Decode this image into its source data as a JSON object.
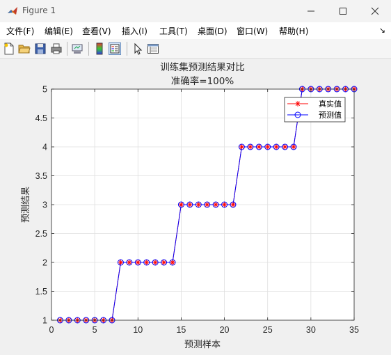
{
  "window": {
    "title": "Figure 1"
  },
  "menu": [
    "文件(F)",
    "编辑(E)",
    "查看(V)",
    "插入(I)",
    "工具(T)",
    "桌面(D)",
    "窗口(W)",
    "帮助(H)"
  ],
  "menu_overflow_icon": "dock-arrow-icon",
  "toolbar": [
    "new-figure-icon",
    "open-file-icon",
    "save-icon",
    "print-icon",
    "link-plot-icon",
    "insert-colorbar-icon",
    "insert-legend-icon",
    "pointer-icon",
    "property-inspector-icon"
  ],
  "chart_data": {
    "type": "line",
    "title": "训练集预测结果对比",
    "subtitle": "准确率=100%",
    "xlabel": "预测样本",
    "ylabel": "预测结果",
    "xlim": [
      0,
      35
    ],
    "ylim": [
      1,
      5
    ],
    "xticks": [
      "0",
      "5",
      "10",
      "15",
      "20",
      "25",
      "30",
      "35"
    ],
    "yticks": [
      "1",
      "1.5",
      "2",
      "2.5",
      "3",
      "3.5",
      "4",
      "4.5",
      "5"
    ],
    "grid": true,
    "legend_position": "top-right",
    "x": [
      1,
      2,
      3,
      4,
      5,
      6,
      7,
      8,
      9,
      10,
      11,
      12,
      13,
      14,
      15,
      16,
      17,
      18,
      19,
      20,
      21,
      22,
      23,
      24,
      25,
      26,
      27,
      28,
      29,
      30,
      31,
      32,
      33,
      34,
      35
    ],
    "series": [
      {
        "name": "真实值",
        "color": "#ff0000",
        "marker": "asterisk",
        "values": [
          1,
          1,
          1,
          1,
          1,
          1,
          1,
          2,
          2,
          2,
          2,
          2,
          2,
          2,
          3,
          3,
          3,
          3,
          3,
          3,
          3,
          4,
          4,
          4,
          4,
          4,
          4,
          4,
          5,
          5,
          5,
          5,
          5,
          5,
          5
        ]
      },
      {
        "name": "预测值",
        "color": "#0000ff",
        "marker": "circle",
        "values": [
          1,
          1,
          1,
          1,
          1,
          1,
          1,
          2,
          2,
          2,
          2,
          2,
          2,
          2,
          3,
          3,
          3,
          3,
          3,
          3,
          3,
          4,
          4,
          4,
          4,
          4,
          4,
          4,
          5,
          5,
          5,
          5,
          5,
          5,
          5
        ]
      }
    ]
  }
}
